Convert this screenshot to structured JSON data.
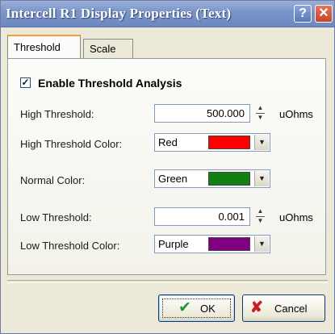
{
  "window": {
    "title": "Intercell R1 Display Properties (Text)",
    "help_glyph": "?",
    "close_glyph": "✕"
  },
  "tabs": [
    {
      "label": "Threshold",
      "selected": true
    },
    {
      "label": "Scale",
      "selected": false
    }
  ],
  "threshold": {
    "enable_checked": true,
    "check_glyph": "✓",
    "enable_label": "Enable Threshold Analysis",
    "high_label": "High Threshold:",
    "high_value": "500.000",
    "high_unit": "uOhms",
    "high_color_label": "High Threshold Color:",
    "high_color_name": "Red",
    "high_color_hex": "#ff0000",
    "normal_color_label": "Normal Color:",
    "normal_color_name": "Green",
    "normal_color_hex": "#108010",
    "low_label": "Low Threshold:",
    "low_value": "0.001",
    "low_unit": "uOhms",
    "low_color_label": "Low Threshold Color:",
    "low_color_name": "Purple",
    "low_color_hex": "#800080"
  },
  "buttons": {
    "ok_label": "OK",
    "ok_icon": "checkmark-icon",
    "cancel_label": "Cancel",
    "cancel_icon": "x-icon"
  }
}
